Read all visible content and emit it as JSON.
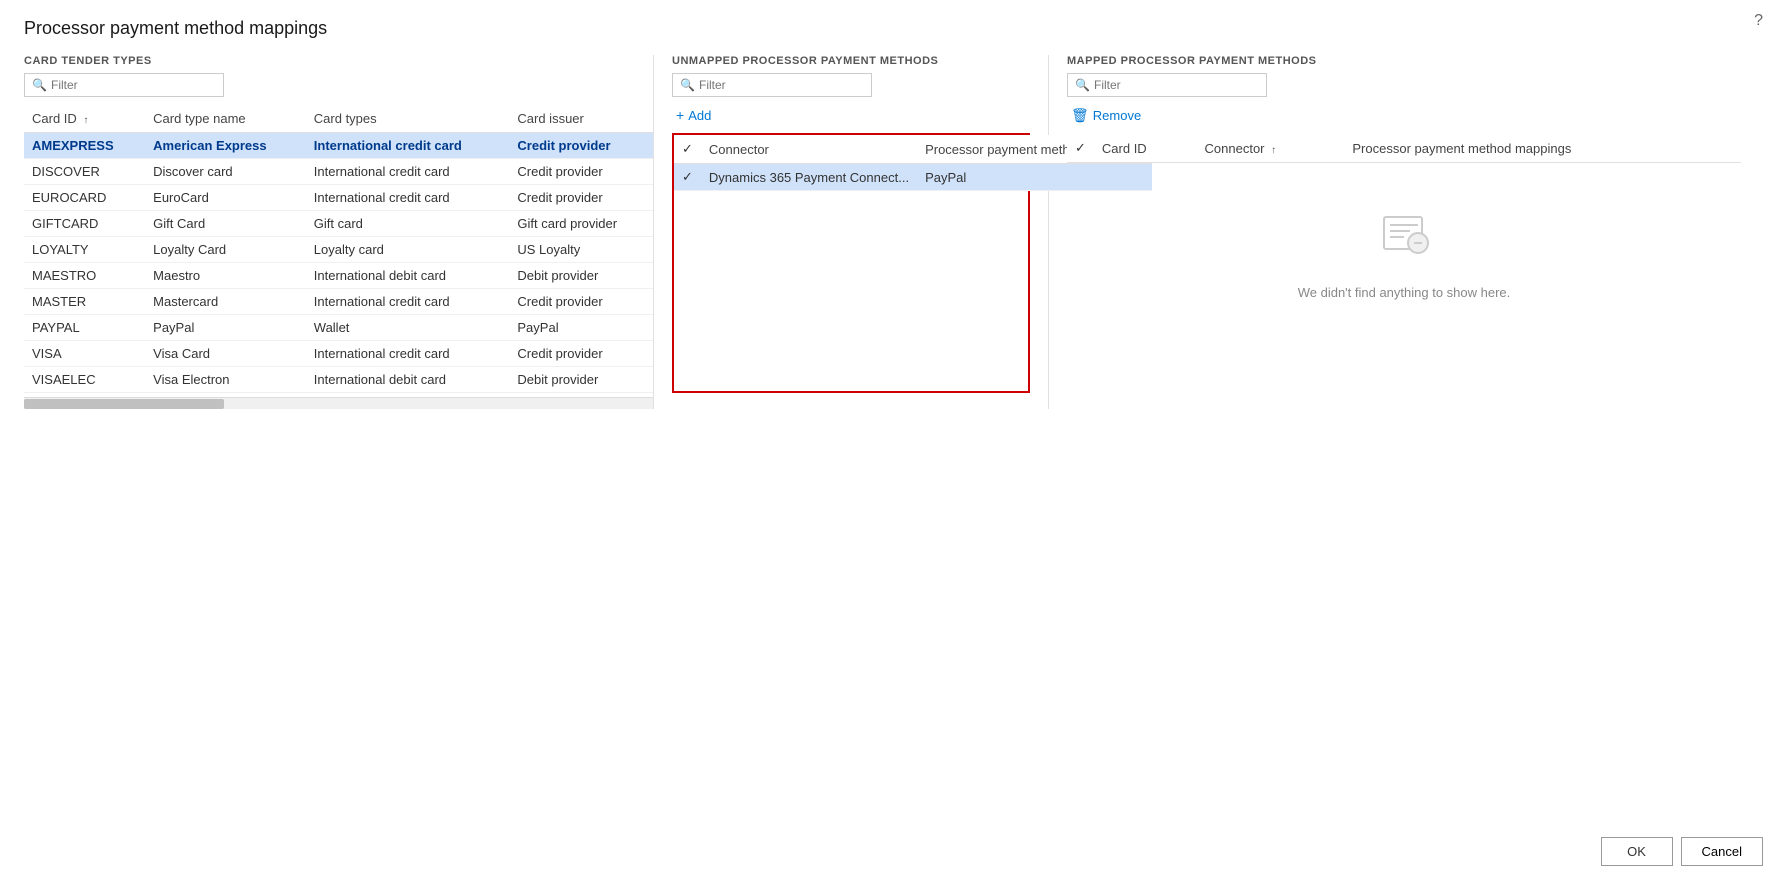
{
  "page": {
    "title": "Processor payment method mappings",
    "help_icon": "?"
  },
  "left_panel": {
    "section_label": "CARD TENDER TYPES",
    "filter_placeholder": "Filter",
    "columns": [
      {
        "key": "card_id",
        "label": "Card ID",
        "sort": "asc"
      },
      {
        "key": "card_type_name",
        "label": "Card type name",
        "sort": null
      },
      {
        "key": "card_types",
        "label": "Card types",
        "sort": null
      },
      {
        "key": "card_issuer",
        "label": "Card issuer",
        "sort": null
      }
    ],
    "rows": [
      {
        "card_id": "AMEXPRESS",
        "card_type_name": "American Express",
        "card_types": "International credit card",
        "card_issuer": "Credit provider",
        "selected": true
      },
      {
        "card_id": "DISCOVER",
        "card_type_name": "Discover card",
        "card_types": "International credit card",
        "card_issuer": "Credit provider",
        "selected": false
      },
      {
        "card_id": "EUROCARD",
        "card_type_name": "EuroCard",
        "card_types": "International credit card",
        "card_issuer": "Credit provider",
        "selected": false
      },
      {
        "card_id": "GIFTCARD",
        "card_type_name": "Gift Card",
        "card_types": "Gift card",
        "card_issuer": "Gift card provider",
        "selected": false
      },
      {
        "card_id": "LOYALTY",
        "card_type_name": "Loyalty Card",
        "card_types": "Loyalty card",
        "card_issuer": "US Loyalty",
        "selected": false
      },
      {
        "card_id": "MAESTRO",
        "card_type_name": "Maestro",
        "card_types": "International debit card",
        "card_issuer": "Debit provider",
        "selected": false
      },
      {
        "card_id": "MASTER",
        "card_type_name": "Mastercard",
        "card_types": "International credit card",
        "card_issuer": "Credit provider",
        "selected": false
      },
      {
        "card_id": "PAYPAL",
        "card_type_name": "PayPal",
        "card_types": "Wallet",
        "card_issuer": "PayPal",
        "selected": false
      },
      {
        "card_id": "VISA",
        "card_type_name": "Visa Card",
        "card_types": "International credit card",
        "card_issuer": "Credit provider",
        "selected": false
      },
      {
        "card_id": "VISAELEC",
        "card_type_name": "Visa Electron",
        "card_types": "International debit card",
        "card_issuer": "Debit provider",
        "selected": false
      }
    ]
  },
  "middle_panel": {
    "section_label": "UNMAPPED PROCESSOR PAYMENT METHODS",
    "filter_placeholder": "Filter",
    "add_button_label": "Add",
    "columns": [
      {
        "key": "check",
        "label": ""
      },
      {
        "key": "connector",
        "label": "Connector"
      },
      {
        "key": "mappings",
        "label": "Processor payment method mappings"
      }
    ],
    "rows": [
      {
        "check": true,
        "connector": "Dynamics 365 Payment Connect...",
        "mappings": "PayPal",
        "selected": true
      }
    ]
  },
  "right_panel": {
    "section_label": "MAPPED PROCESSOR PAYMENT METHODS",
    "filter_placeholder": "Filter",
    "remove_button_label": "Remove",
    "columns": [
      {
        "key": "check",
        "label": ""
      },
      {
        "key": "card_id",
        "label": "Card ID"
      },
      {
        "key": "connector",
        "label": "Connector",
        "sort": "asc"
      },
      {
        "key": "mappings",
        "label": "Processor payment method mappings"
      }
    ],
    "rows": [],
    "empty_state_text": "We didn't find anything to show here."
  },
  "buttons": {
    "ok_label": "OK",
    "cancel_label": "Cancel"
  }
}
